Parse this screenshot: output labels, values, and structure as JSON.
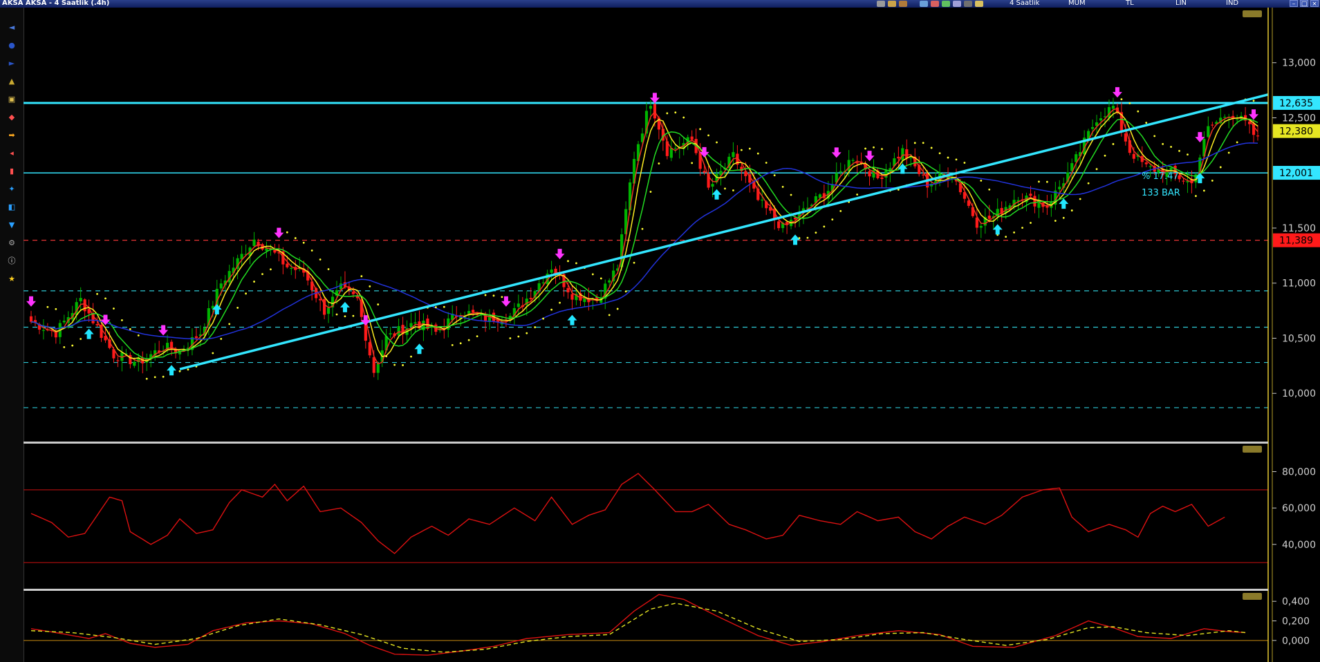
{
  "window": {
    "title": "AKSA AKSA - 4 Saatlik (.4h)",
    "period_label": "4 Saatlik",
    "chart_style_label": "MUM",
    "currency_label": "TL",
    "scale_label": "LIN",
    "indicator_label": "IND"
  },
  "toolbar_icons": [
    "pointer-icon",
    "crosshair-icon",
    "zoom-icon",
    "draw-line-icon",
    "fib-icon",
    "text-icon",
    "arrow-icon",
    "eraser-icon",
    "magnet-icon",
    "cursor-icon",
    "lock-icon",
    "trash-icon",
    "settings-icon",
    "info-icon",
    "star-icon"
  ],
  "colors": {
    "background": "#000000",
    "up_candle": "#00b400",
    "down_candle": "#ff1a1a",
    "resistance_line": "#33e6ff",
    "trend_line": "#33e6ff",
    "support_line": "#ff3b3b",
    "dashed_levels": "#2ec9d6",
    "ma_blue": "#2233dd",
    "ma_green": "#22dd22",
    "ma_yellow": "#ffee22",
    "ma_red": "#ee3322",
    "sar_dots": "#ffff33",
    "rsi_line": "#dd1111",
    "macd_line": "#dd1111",
    "signal_line": "#e6e622",
    "buy_arrow": "#22e6ff",
    "sell_arrow": "#ff33ff",
    "panel_border": "#cccccc"
  },
  "annotations": {
    "percent_label": "% 17.47",
    "bars_label": "133 BAR"
  },
  "chart_data": [
    {
      "type": "candlestick",
      "panel": "price",
      "y_ticks": [
        "13,000",
        "12,500",
        "11,500",
        "11,000",
        "10,500",
        "10,000"
      ],
      "y_tick_values": [
        13.0,
        12.5,
        11.5,
        11.0,
        10.5,
        10.0
      ],
      "ylim": [
        9.55,
        13.5
      ],
      "grid": false,
      "level_labels": [
        {
          "text": "12,635",
          "value": 12.635,
          "bg": "#33e6ff",
          "fg": "#000000"
        },
        {
          "text": "12,380",
          "value": 12.38,
          "bg": "#e6e622",
          "fg": "#000000"
        },
        {
          "text": "12,001",
          "value": 12.001,
          "bg": "#33e6ff",
          "fg": "#000000"
        },
        {
          "text": "11,389",
          "value": 11.389,
          "bg": "#ff1a1a",
          "fg": "#000000"
        }
      ],
      "horizontal_lines": [
        {
          "value": 12.635,
          "style": "solid",
          "color": "#33e6ff"
        },
        {
          "value": 12.0,
          "style": "solid",
          "color": "#33e6ff"
        },
        {
          "value": 11.389,
          "style": "dashed",
          "color": "#ff3b3b"
        },
        {
          "value": 10.93,
          "style": "dashed",
          "color": "#2ec9d6"
        },
        {
          "value": 10.6,
          "style": "dashed",
          "color": "#2ec9d6"
        },
        {
          "value": 10.28,
          "style": "dashed",
          "color": "#2ec9d6"
        },
        {
          "value": 9.87,
          "style": "dashed",
          "color": "#2ec9d6"
        }
      ],
      "trend_line": {
        "from": [
          36,
          10.22
        ],
        "to": [
          256,
          12.3
        ]
      },
      "close_anchors": [
        [
          0,
          10.65
        ],
        [
          6,
          10.55
        ],
        [
          12,
          10.85
        ],
        [
          20,
          10.35
        ],
        [
          26,
          10.28
        ],
        [
          32,
          10.42
        ],
        [
          36,
          10.38
        ],
        [
          41,
          10.55
        ],
        [
          46,
          11.0
        ],
        [
          54,
          11.4
        ],
        [
          58,
          11.3
        ],
        [
          62,
          11.15
        ],
        [
          66,
          11.1
        ],
        [
          71,
          10.75
        ],
        [
          75,
          10.95
        ],
        [
          79,
          10.85
        ],
        [
          83,
          10.2
        ],
        [
          86,
          10.5
        ],
        [
          93,
          10.65
        ],
        [
          98,
          10.55
        ],
        [
          104,
          10.75
        ],
        [
          110,
          10.68
        ],
        [
          116,
          10.7
        ],
        [
          121,
          10.9
        ],
        [
          126,
          11.15
        ],
        [
          131,
          10.9
        ],
        [
          137,
          10.85
        ],
        [
          142,
          11.15
        ],
        [
          146,
          12.15
        ],
        [
          150,
          12.65
        ],
        [
          154,
          12.2
        ],
        [
          160,
          12.3
        ],
        [
          164,
          11.85
        ],
        [
          170,
          12.15
        ],
        [
          176,
          11.75
        ],
        [
          182,
          11.5
        ],
        [
          187,
          11.65
        ],
        [
          193,
          11.85
        ],
        [
          199,
          12.15
        ],
        [
          205,
          11.95
        ],
        [
          211,
          12.2
        ],
        [
          217,
          11.9
        ],
        [
          223,
          12.0
        ],
        [
          229,
          11.55
        ],
        [
          233,
          11.6
        ],
        [
          239,
          11.8
        ],
        [
          246,
          11.7
        ],
        [
          252,
          12.05
        ],
        [
          258,
          12.5
        ],
        [
          262,
          12.6
        ],
        [
          266,
          12.2
        ],
        [
          270,
          12.05
        ],
        [
          276,
          12.0
        ],
        [
          281,
          11.9
        ],
        [
          285,
          12.4
        ],
        [
          290,
          12.55
        ],
        [
          294,
          12.45
        ],
        [
          297,
          12.3
        ]
      ],
      "moving_averages": [
        {
          "name": "",
          "color": "#ee3322",
          "period": 3
        },
        {
          "name": "",
          "color": "#ffee22",
          "period": 5
        },
        {
          "name": "",
          "color": "#22dd22",
          "period": 9
        },
        {
          "name": "",
          "color": "#2233dd",
          "period": 40
        }
      ],
      "buy_signals": [
        14,
        34,
        45,
        76,
        94,
        131,
        166,
        185,
        211,
        234,
        250,
        283
      ],
      "sell_signals": [
        0,
        18,
        32,
        60,
        81,
        115,
        128,
        151,
        163,
        195,
        203,
        263,
        283,
        296
      ]
    },
    {
      "type": "line",
      "panel": "rsi",
      "y_ticks": [
        "80,000",
        "60,000",
        "40,000"
      ],
      "y_tick_values": [
        80,
        60,
        40
      ],
      "ylim": [
        16,
        95
      ],
      "reference_lines": [
        70,
        30
      ],
      "anchors": [
        [
          0,
          57
        ],
        [
          5,
          52
        ],
        [
          9,
          44
        ],
        [
          13,
          46
        ],
        [
          16,
          56
        ],
        [
          19,
          66
        ],
        [
          22,
          64
        ],
        [
          24,
          47
        ],
        [
          29,
          40
        ],
        [
          33,
          45
        ],
        [
          36,
          54
        ],
        [
          40,
          46
        ],
        [
          44,
          48
        ],
        [
          48,
          63
        ],
        [
          51,
          70
        ],
        [
          56,
          66
        ],
        [
          59,
          73
        ],
        [
          62,
          64
        ],
        [
          66,
          72
        ],
        [
          70,
          58
        ],
        [
          75,
          60
        ],
        [
          80,
          52
        ],
        [
          84,
          42
        ],
        [
          88,
          35
        ],
        [
          92,
          44
        ],
        [
          97,
          50
        ],
        [
          101,
          45
        ],
        [
          106,
          54
        ],
        [
          111,
          51
        ],
        [
          117,
          60
        ],
        [
          122,
          53
        ],
        [
          126,
          66
        ],
        [
          131,
          51
        ],
        [
          135,
          56
        ],
        [
          139,
          59
        ],
        [
          143,
          73
        ],
        [
          147,
          79
        ],
        [
          151,
          70
        ],
        [
          156,
          58
        ],
        [
          160,
          58
        ],
        [
          164,
          62
        ],
        [
          169,
          51
        ],
        [
          173,
          48
        ],
        [
          178,
          43
        ],
        [
          182,
          45
        ],
        [
          186,
          56
        ],
        [
          191,
          53
        ],
        [
          196,
          51
        ],
        [
          200,
          58
        ],
        [
          205,
          53
        ],
        [
          210,
          55
        ],
        [
          214,
          47
        ],
        [
          218,
          43
        ],
        [
          222,
          50
        ],
        [
          226,
          55
        ],
        [
          231,
          51
        ],
        [
          235,
          56
        ],
        [
          240,
          66
        ],
        [
          245,
          70
        ],
        [
          249,
          71
        ],
        [
          252,
          55
        ],
        [
          256,
          47
        ],
        [
          261,
          51
        ],
        [
          265,
          48
        ],
        [
          268,
          44
        ],
        [
          271,
          57
        ],
        [
          274,
          61
        ],
        [
          277,
          58
        ],
        [
          281,
          62
        ],
        [
          285,
          50
        ],
        [
          289,
          55
        ]
      ]
    },
    {
      "type": "line",
      "panel": "macd",
      "y_ticks": [
        "0,400",
        "0,200",
        "0,000"
      ],
      "y_tick_values": [
        0.4,
        0.2,
        0.0
      ],
      "ylim": [
        -0.22,
        0.5
      ],
      "reference_lines": [
        0
      ],
      "series": [
        {
          "anchors": [
            [
              0,
              0.12
            ],
            [
              6,
              0.08
            ],
            [
              14,
              0.02
            ],
            [
              18,
              0.07
            ],
            [
              24,
              -0.03
            ],
            [
              30,
              -0.07
            ],
            [
              38,
              -0.04
            ],
            [
              44,
              0.1
            ],
            [
              52,
              0.18
            ],
            [
              60,
              0.2
            ],
            [
              68,
              0.17
            ],
            [
              76,
              0.07
            ],
            [
              82,
              -0.05
            ],
            [
              88,
              -0.14
            ],
            [
              96,
              -0.15
            ],
            [
              104,
              -0.11
            ],
            [
              112,
              -0.06
            ],
            [
              120,
              0.02
            ],
            [
              130,
              0.06
            ],
            [
              140,
              0.08
            ],
            [
              146,
              0.3
            ],
            [
              152,
              0.47
            ],
            [
              158,
              0.42
            ],
            [
              166,
              0.25
            ],
            [
              176,
              0.05
            ],
            [
              184,
              -0.05
            ],
            [
              192,
              -0.01
            ],
            [
              200,
              0.05
            ],
            [
              210,
              0.1
            ],
            [
              220,
              0.06
            ],
            [
              228,
              -0.06
            ],
            [
              238,
              -0.07
            ],
            [
              248,
              0.05
            ],
            [
              256,
              0.2
            ],
            [
              262,
              0.13
            ],
            [
              268,
              0.04
            ],
            [
              276,
              0.02
            ],
            [
              284,
              0.12
            ],
            [
              290,
              0.09
            ],
            [
              294,
              0.08
            ]
          ]
        },
        {
          "anchors": [
            [
              0,
              0.1
            ],
            [
              10,
              0.08
            ],
            [
              20,
              0.03
            ],
            [
              30,
              -0.04
            ],
            [
              40,
              0.02
            ],
            [
              50,
              0.15
            ],
            [
              60,
              0.22
            ],
            [
              70,
              0.16
            ],
            [
              80,
              0.06
            ],
            [
              90,
              -0.08
            ],
            [
              100,
              -0.12
            ],
            [
              110,
              -0.09
            ],
            [
              120,
              -0.01
            ],
            [
              130,
              0.04
            ],
            [
              140,
              0.06
            ],
            [
              150,
              0.32
            ],
            [
              156,
              0.38
            ],
            [
              166,
              0.3
            ],
            [
              176,
              0.12
            ],
            [
              186,
              -0.01
            ],
            [
              196,
              0.01
            ],
            [
              206,
              0.07
            ],
            [
              216,
              0.08
            ],
            [
              226,
              0.01
            ],
            [
              236,
              -0.05
            ],
            [
              246,
              0.01
            ],
            [
              256,
              0.13
            ],
            [
              262,
              0.14
            ],
            [
              270,
              0.08
            ],
            [
              280,
              0.05
            ],
            [
              290,
              0.1
            ],
            [
              294,
              0.08
            ]
          ]
        }
      ]
    }
  ]
}
